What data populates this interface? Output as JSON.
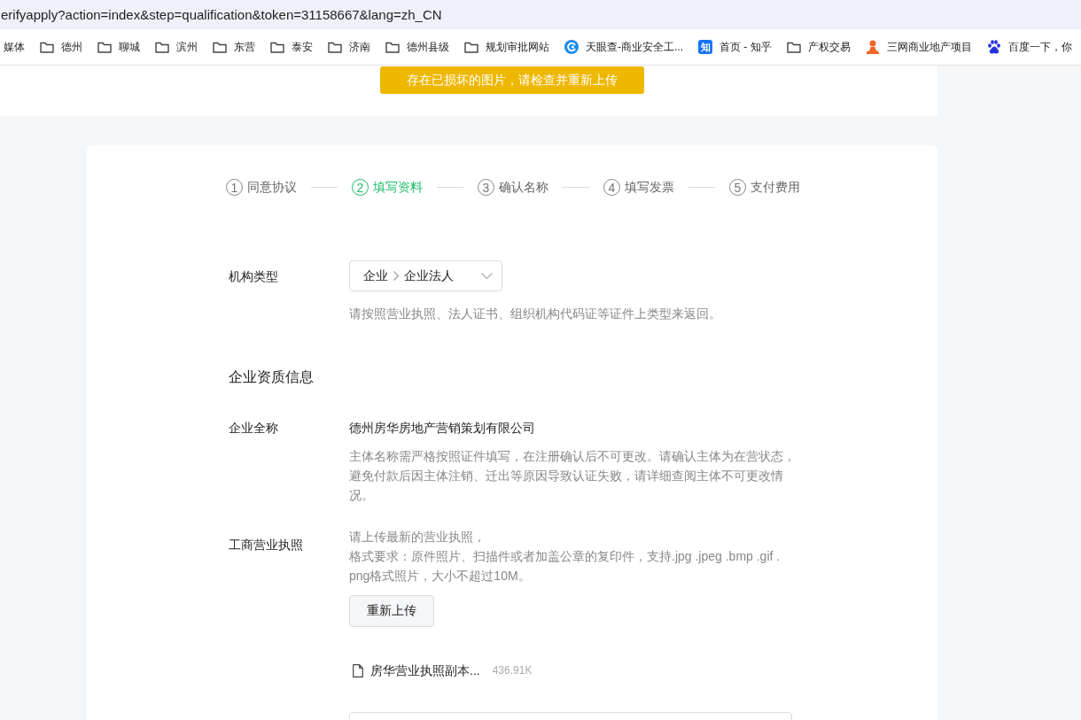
{
  "address_bar": {
    "url": "erifyapply?action=index&step=qualification&token=31158667&lang=zh_CN"
  },
  "bookmarks": [
    {
      "kind": "plain",
      "label": "媒体"
    },
    {
      "kind": "folder",
      "label": "德州"
    },
    {
      "kind": "folder",
      "label": "聊城"
    },
    {
      "kind": "folder",
      "label": "滨州"
    },
    {
      "kind": "folder",
      "label": "东营"
    },
    {
      "kind": "folder",
      "label": "泰安"
    },
    {
      "kind": "folder",
      "label": "济南"
    },
    {
      "kind": "folder",
      "label": "德州县级"
    },
    {
      "kind": "folder",
      "label": "规划审批网站"
    },
    {
      "kind": "swirl",
      "label": "天眼查-商业安全工..."
    },
    {
      "kind": "tile",
      "icon_text": "知",
      "label": "首页 - 知乎"
    },
    {
      "kind": "folder",
      "label": "产权交易"
    },
    {
      "kind": "person",
      "label": "三网商业地产项目"
    },
    {
      "kind": "paw",
      "label": "百度一下，你"
    }
  ],
  "alert": {
    "kind": "warning",
    "text": "存在已损坏的图片，请检查并重新上传"
  },
  "steps": [
    {
      "number": "1",
      "label": "同意协议",
      "selected": false
    },
    {
      "number": "2",
      "label": "填写资料",
      "selected": true
    },
    {
      "number": "3",
      "label": "确认名称",
      "selected": false
    },
    {
      "number": "4",
      "label": "填写发票",
      "selected": false
    },
    {
      "number": "5",
      "label": "支付费用",
      "selected": false
    }
  ],
  "org_type": {
    "label": "机构类型",
    "path": [
      "企业",
      "企业法人"
    ],
    "hint": "请按照营业执照、法人证书、组织机构代码证等证件上类型来返回。"
  },
  "section_title": "企业资质信息",
  "company_name": {
    "label": "企业全称",
    "value": "德州房华房地产营销策划有限公司",
    "hint": "主体名称需严格按照证件填写，在注册确认后不可更改。请确认主体为在营状态，避免付款后因主体注销、迁出等原因导致认证失败，请详细查阅主体不可更改情况。"
  },
  "license": {
    "label": "工商营业执照",
    "hints": [
      "请上传最新的营业执照，",
      "格式要求：原件照片、扫描件或者加盖公章的复印件，支持.jpg .jpeg .bmp .gif .png格式照片，大小不超过10M。"
    ],
    "button": "重新上传",
    "file": {
      "name": "房华营业执照副本...",
      "size": "436.91K"
    }
  }
}
